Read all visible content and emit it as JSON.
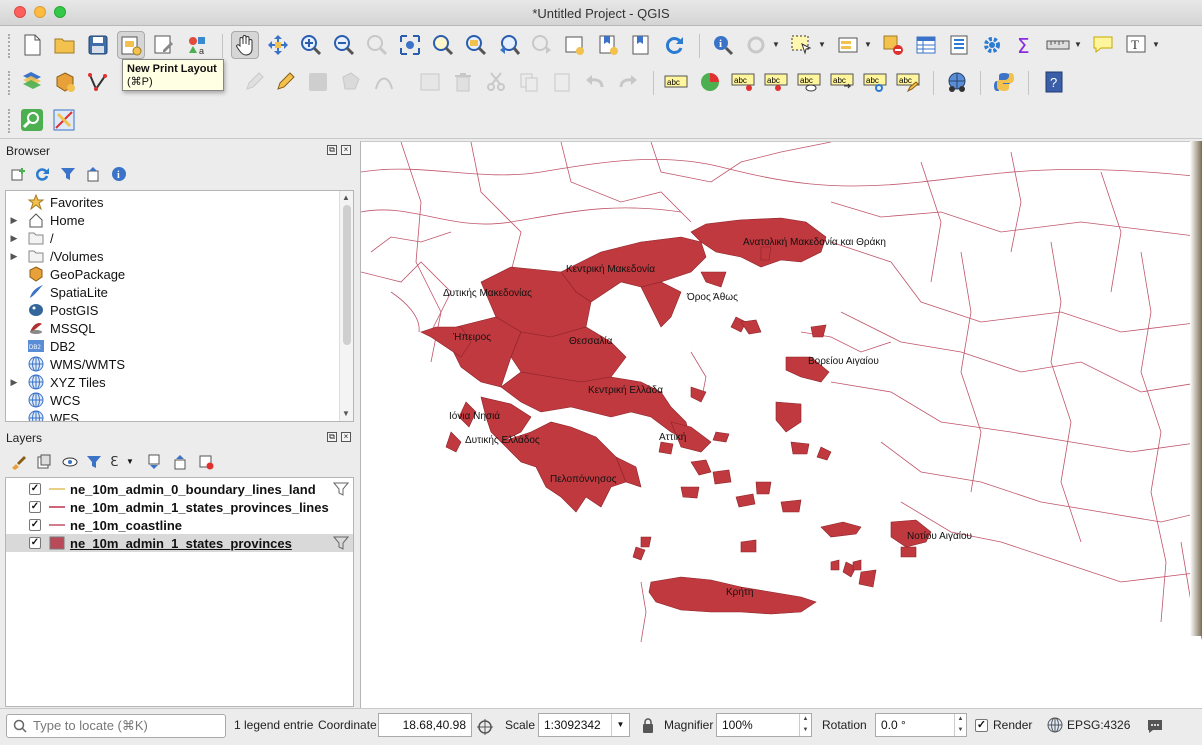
{
  "window": {
    "title": "*Untitled Project - QGIS"
  },
  "tooltip": {
    "title": "New Print Layout",
    "shortcut": "(⌘P)"
  },
  "browser": {
    "title": "Browser",
    "items": [
      {
        "label": "Favorites",
        "icon": "star-icon",
        "expandable": false
      },
      {
        "label": "Home",
        "icon": "home-icon",
        "expandable": true
      },
      {
        "label": "/",
        "icon": "folder-icon",
        "expandable": true
      },
      {
        "label": "/Volumes",
        "icon": "folder-icon",
        "expandable": true
      },
      {
        "label": "GeoPackage",
        "icon": "geopackage-icon",
        "expandable": false
      },
      {
        "label": "SpatiaLite",
        "icon": "spatialite-icon",
        "expandable": false
      },
      {
        "label": "PostGIS",
        "icon": "postgis-icon",
        "expandable": false
      },
      {
        "label": "MSSQL",
        "icon": "mssql-icon",
        "expandable": false
      },
      {
        "label": "DB2",
        "icon": "db2-icon",
        "expandable": false
      },
      {
        "label": "WMS/WMTS",
        "icon": "globe-icon",
        "expandable": false
      },
      {
        "label": "XYZ Tiles",
        "icon": "globe-icon",
        "expandable": true
      },
      {
        "label": "WCS",
        "icon": "globe-icon",
        "expandable": false
      },
      {
        "label": "WFS",
        "icon": "globe-icon",
        "expandable": false
      }
    ]
  },
  "layers": {
    "title": "Layers",
    "items": [
      {
        "name": "ne_10m_admin_0_boundary_lines_land",
        "checked": true,
        "symbol": "line",
        "color": "#e0c060",
        "filter": true,
        "selected": false
      },
      {
        "name": "ne_10m_admin_1_states_provinces_lines",
        "checked": true,
        "symbol": "line",
        "color": "#c0304a",
        "filter": false,
        "selected": false
      },
      {
        "name": "ne_10m_coastline",
        "checked": true,
        "symbol": "line",
        "color": "#c45068",
        "filter": false,
        "selected": false
      },
      {
        "name": "ne_10m_admin_1_states_provinces",
        "checked": true,
        "symbol": "fill",
        "color": "#b94a5a",
        "filter": true,
        "selected": true
      }
    ]
  },
  "map": {
    "fill_color": "#c0393f",
    "line_color": "#c0556a",
    "labels": [
      "Ανατολική Μακεδονία και Θράκη",
      "Κεντρική Μακεδονία",
      "Δυτικής Μακεδονίας",
      "Όρος Άθως",
      "Ήπειρος",
      "Θεσσαλία",
      "Βορείου Αιγαίου",
      "Κεντρική Ελλάδα",
      "Ιόνια Νησιά",
      "Αττική",
      "Δυτικής Ελλάδος",
      "Πελοπόννησος",
      "Νοτίου Αιγαίου",
      "Κρήτη"
    ]
  },
  "status": {
    "locate_placeholder": "Type to locate (⌘K)",
    "legend_text": "1 legend entrie",
    "coordinate_label": "Coordinate",
    "coordinate_value": "18.68,40.98",
    "scale_label": "Scale",
    "scale_value": "1:3092342",
    "magnifier_label": "Magnifier",
    "magnifier_value": "100%",
    "rotation_label": "Rotation",
    "rotation_value": "0.0 °",
    "render_label": "Render",
    "render_checked": true,
    "crs": "EPSG:4326"
  }
}
